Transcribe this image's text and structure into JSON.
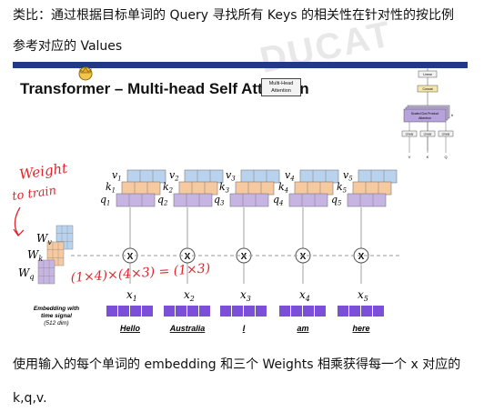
{
  "text": {
    "line1": "类比：通过根据目标单词的 Query 寻找所有 Keys 的相关性在针对性的按比例",
    "line2": "参考对应的 Values",
    "line3": "使用输入的每个单词的 embedding 和三个 Weights 相乘获得每一个 x 对应的",
    "line4": "k,q,v."
  },
  "slide": {
    "title": "Transformer – Multi-head Self Attention",
    "mh_line1": "Multi-Head",
    "mh_line2": "Attention",
    "watermark": "DUCAT"
  },
  "arch": {
    "top_box": "Linear",
    "concat": "Concat",
    "sdpa_line1": "Scaled Dot-Product",
    "sdpa_line2": "Attention",
    "h_label": "h",
    "linear": "Linear",
    "v": "V",
    "k": "K",
    "q": "Q"
  },
  "embedding_label": {
    "l1": "Embedding with",
    "l2": "time signal",
    "l3": "(512 dim)"
  },
  "weights": {
    "wv": "W",
    "wv_sub": "v",
    "wk": "W",
    "wk_sub": "k",
    "wq": "W",
    "wq_sub": "q"
  },
  "words": [
    {
      "word": "Hello",
      "x": "x",
      "idx": "1"
    },
    {
      "word": "Australia",
      "x": "x",
      "idx": "2"
    },
    {
      "word": "I",
      "x": "x",
      "idx": "3"
    },
    {
      "word": "am",
      "x": "x",
      "idx": "4"
    },
    {
      "word": "here",
      "x": "x",
      "idx": "5"
    }
  ],
  "vkq": {
    "v": "v",
    "k": "k",
    "q": "q",
    "indices": [
      "1",
      "2",
      "3",
      "4",
      "5"
    ]
  },
  "multiply_symbol": "X",
  "annotation": {
    "line1": "Weight",
    "line2": "to train",
    "formula": "(1×4)×(4×3) = (1×3)"
  },
  "colors": {
    "banner": "#1f3b86",
    "v_box": "#b9d3ef",
    "k_box": "#f6c9a0",
    "q_box": "#c6b4e3",
    "embedding": "#7b4fd8",
    "annotation": "#e0242b"
  }
}
